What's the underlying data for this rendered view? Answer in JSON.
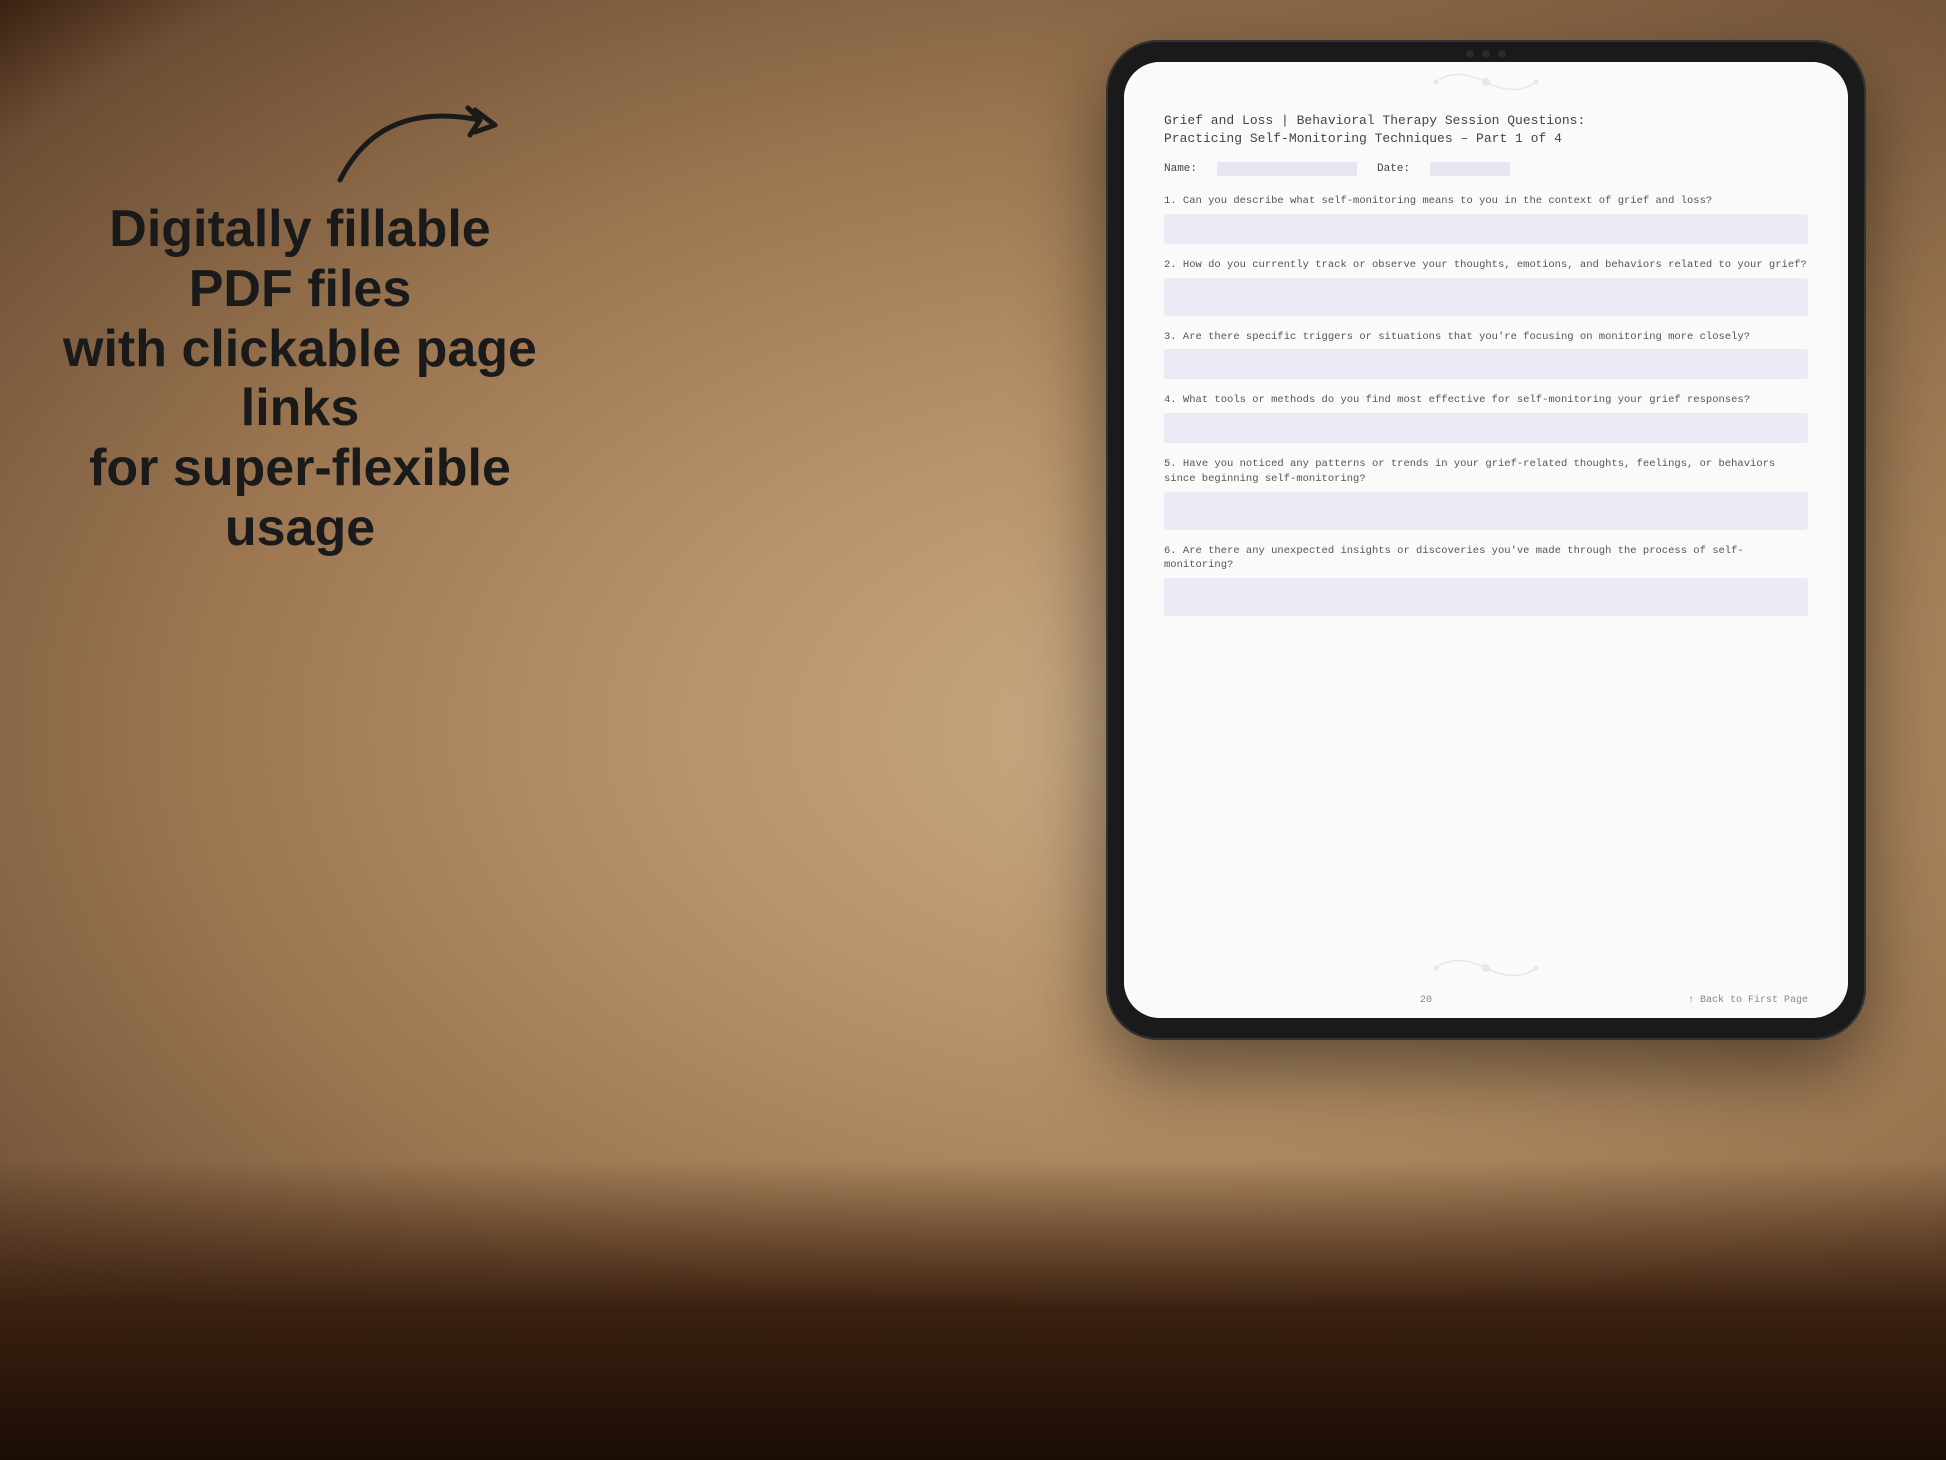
{
  "background": {
    "color": "#c4a882"
  },
  "left_text": {
    "line1": "Digitally fillable PDF files",
    "line2": "with clickable page links",
    "line3": "for super-flexible usage"
  },
  "arrow": {
    "description": "curved arrow pointing right toward tablet"
  },
  "tablet": {
    "pdf_page": {
      "title_line1": "Grief and Loss | Behavioral Therapy Session Questions:",
      "title_line2": "Practicing Self-Monitoring Techniques  – Part 1 of 4",
      "name_label": "Name:",
      "date_label": "Date:",
      "questions": [
        {
          "number": "1.",
          "text": "Can you describe what self-monitoring means to you in the context of grief and loss?"
        },
        {
          "number": "2.",
          "text": "How do you currently track or observe your thoughts, emotions, and behaviors related to your grief?"
        },
        {
          "number": "3.",
          "text": "Are there specific triggers or situations that you're focusing on monitoring more closely?"
        },
        {
          "number": "4.",
          "text": "What tools or methods do you find most effective for self-monitoring your grief responses?"
        },
        {
          "number": "5.",
          "text": "Have you noticed any patterns or trends in your grief-related thoughts, feelings, or behaviors since beginning self-monitoring?"
        },
        {
          "number": "6.",
          "text": "Are there any unexpected insights or discoveries you've made through the process of self-monitoring?"
        }
      ],
      "footer_page_number": "20",
      "footer_link": "↑ Back to First Page"
    }
  }
}
